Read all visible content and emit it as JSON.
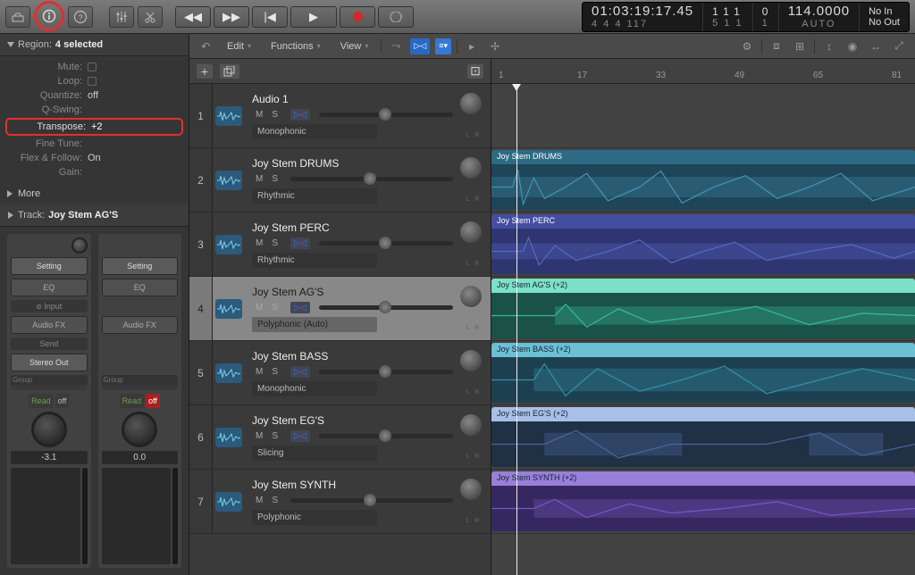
{
  "toolbar": {
    "transport": {
      "rewind": "◀◀",
      "ff": "▶▶",
      "start": "|◀",
      "play": "▶",
      "stop": ""
    }
  },
  "lcd": {
    "timecode": "01:03:19:17.45",
    "sub": "4  4  4  117",
    "bars1": "1  1  1",
    "bars2": "5  1  1",
    "keysig": "0",
    "keysig2": "1",
    "tempo": "114.0000",
    "tempomode": "AUTO",
    "noin": "No In",
    "noout": "No Out"
  },
  "inspector": {
    "header_label": "Region:",
    "header_value": "4 selected",
    "rows": {
      "mute": "Mute:",
      "loop": "Loop:",
      "quantize_lbl": "Quantize:",
      "quantize_val": "off",
      "qswing": "Q-Swing:",
      "transpose_lbl": "Transpose:",
      "transpose_val": "+2",
      "finetune": "Fine Tune:",
      "flex_lbl": "Flex & Follow:",
      "flex_val": "On",
      "gain": "Gain:"
    },
    "more": "More",
    "track_label": "Track:",
    "track_name": "Joy Stem AG'S",
    "chan": {
      "setting": "Setting",
      "eq": "EQ",
      "input": "Input",
      "audiofx": "Audio FX",
      "send": "Send",
      "stereoout": "Stereo Out",
      "group": "Group",
      "read": "Read",
      "off": "off",
      "val1": "-3.1",
      "val2": "0.0"
    }
  },
  "mainbar": {
    "edit": "Edit",
    "functions": "Functions",
    "view": "View"
  },
  "ruler": {
    "t1": "1",
    "t17": "17",
    "t33": "33",
    "t49": "49",
    "t65": "65",
    "t81": "81"
  },
  "tracks": [
    {
      "num": "1",
      "name": "Audio 1",
      "mode": "Monophonic",
      "flex": true,
      "m": "M",
      "s": "S"
    },
    {
      "num": "2",
      "name": "Joy Stem DRUMS",
      "mode": "Rhythmic",
      "flex": false,
      "m": "M",
      "s": "S"
    },
    {
      "num": "3",
      "name": "Joy Stem PERC",
      "mode": "Rhythmic",
      "flex": true,
      "m": "M",
      "s": "S"
    },
    {
      "num": "4",
      "name": "Joy Stem AG'S",
      "mode": "Polyphonic (Auto)",
      "flex": true,
      "m": "M",
      "s": "S",
      "selected": true
    },
    {
      "num": "5",
      "name": "Joy Stem BASS",
      "mode": "Monophonic",
      "flex": true,
      "m": "M",
      "s": "S"
    },
    {
      "num": "6",
      "name": "Joy Stem EG'S",
      "mode": "Slicing",
      "flex": true,
      "m": "M",
      "s": "S"
    },
    {
      "num": "7",
      "name": "Joy Stem SYNTH",
      "mode": "Polyphonic",
      "flex": false,
      "m": "M",
      "s": "S"
    }
  ],
  "clips": [
    {
      "row": 1,
      "label": "Joy Stem DRUMS",
      "cls": "drums"
    },
    {
      "row": 2,
      "label": "Joy Stem PERC",
      "cls": "perc"
    },
    {
      "row": 3,
      "label": "Joy Stem AG'S (+2)",
      "cls": "ags"
    },
    {
      "row": 4,
      "label": "Joy Stem BASS (+2)",
      "cls": "bass"
    },
    {
      "row": 5,
      "label": "Joy Stem EG'S (+2)",
      "cls": "egs"
    },
    {
      "row": 6,
      "label": "Joy Stem SYNTH (+2)",
      "cls": "synth"
    }
  ]
}
